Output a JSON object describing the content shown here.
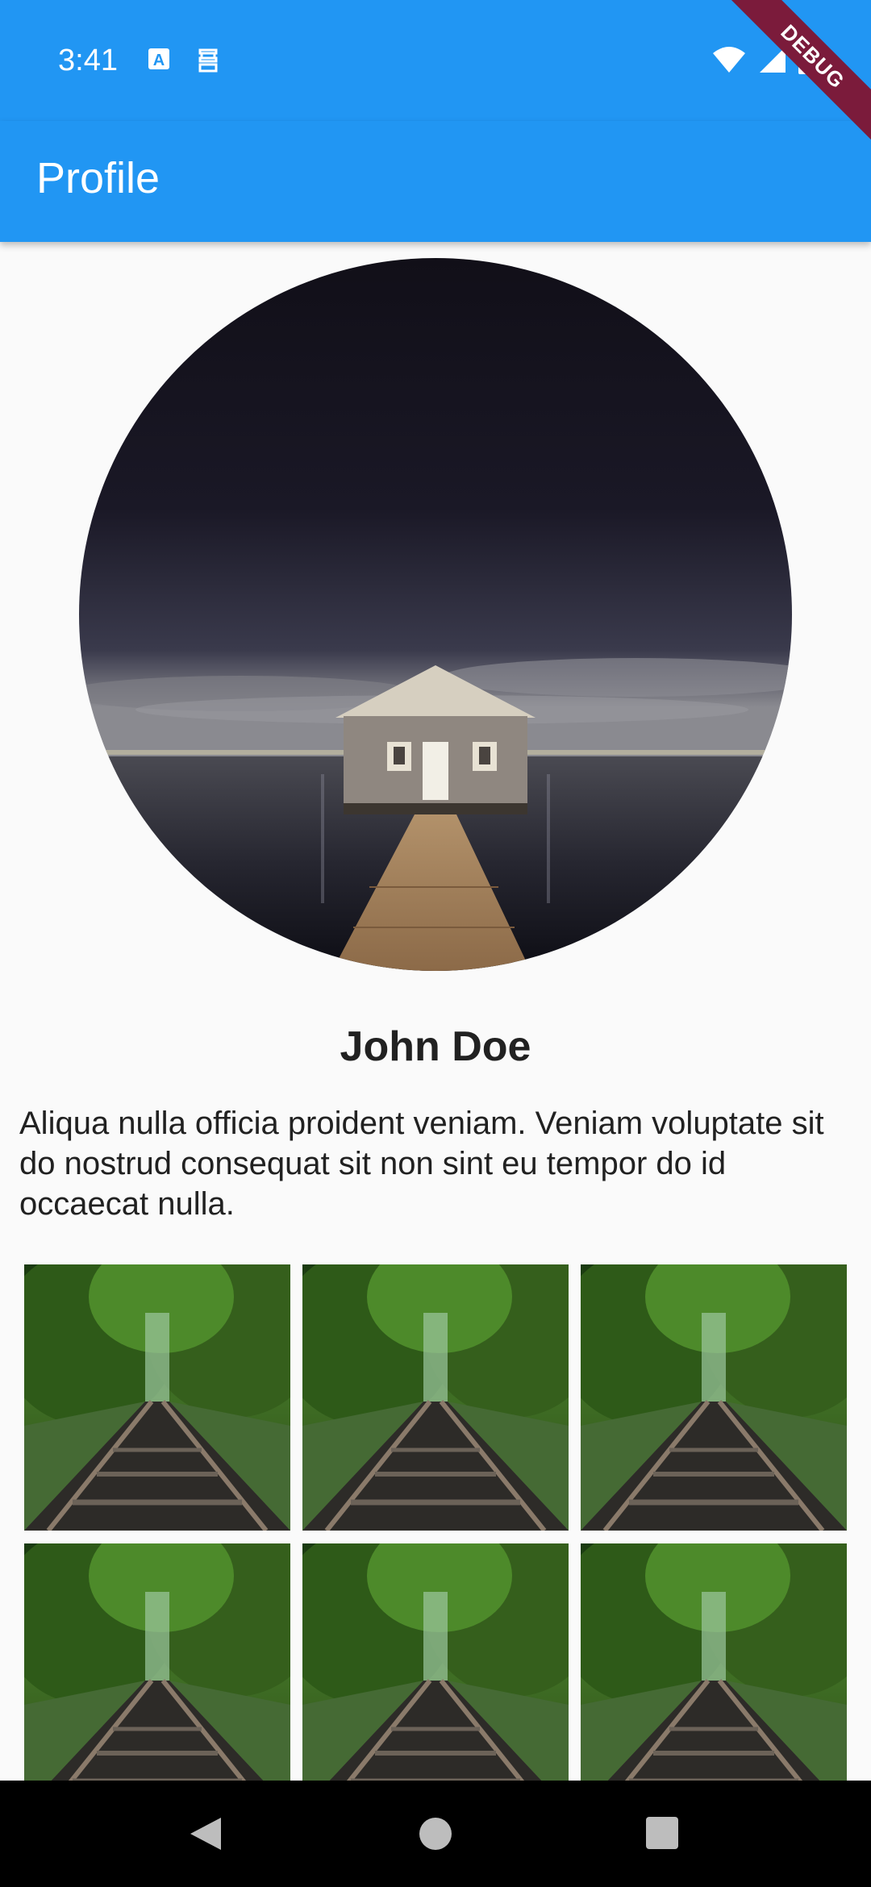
{
  "status_bar": {
    "time": "3:41",
    "icons": [
      "a-notification-icon",
      "sim-notification-icon",
      "wifi-icon",
      "signal-icon",
      "battery-icon"
    ]
  },
  "app_bar": {
    "title": "Profile"
  },
  "debug_banner": "DEBUG",
  "profile": {
    "name": "John Doe",
    "bio": "Aliqua nulla officia proident veniam. Veniam voluptate sit do nostrud consequat sit non sint eu tempor do id occaecat nulla."
  },
  "gallery": {
    "image_subject": "railway-track-forest",
    "count_visible": 6
  },
  "navigation": {
    "buttons": [
      "back-icon",
      "home-icon",
      "recents-icon"
    ]
  },
  "colors": {
    "primary": "#2196f3",
    "background": "#fafafa",
    "debug": "#7b1b3b"
  }
}
